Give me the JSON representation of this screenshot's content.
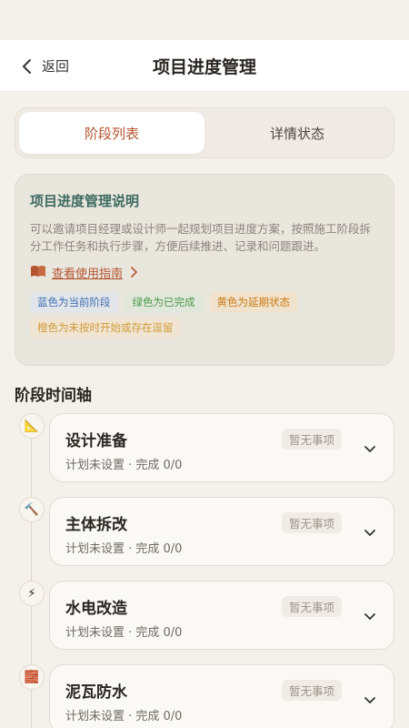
{
  "header": {
    "back_label": "返回",
    "title": "项目进度管理"
  },
  "tabs": [
    {
      "label": "阶段列表",
      "active": true
    },
    {
      "label": "详情状态",
      "active": false
    }
  ],
  "info": {
    "title": "项目进度管理说明",
    "description": "可以邀请项目经理或设计师一起规划项目进度方案，按照施工阶段拆分工作任务和执行步骤，方便后续推进、记录和问题跟进。",
    "guide_label": "查看使用指南",
    "legend": [
      {
        "label": "蓝色为当前阶段",
        "color": "#3e6fb2"
      },
      {
        "label": "绿色为已完成",
        "color": "#4c9a4c"
      },
      {
        "label": "黄色为延期状态",
        "color": "#c97a12"
      },
      {
        "label": "橙色为未按时开始或存在逗留",
        "color": "#d29a3a"
      }
    ]
  },
  "timeline": {
    "title": "阶段时间轴",
    "stages": [
      {
        "icon": "ruler-triangle-icon",
        "glyph": "📐",
        "name": "设计准备",
        "meta": "计划未设置 · 完成 0/0",
        "badge": "暂无事项"
      },
      {
        "icon": "hammer-icon",
        "glyph": "🔨",
        "name": "主体拆改",
        "meta": "计划未设置 · 完成 0/0",
        "badge": "暂无事项"
      },
      {
        "icon": "lightning-icon",
        "glyph": "⚡",
        "name": "水电改造",
        "meta": "计划未设置 · 完成 0/0",
        "badge": "暂无事项"
      },
      {
        "icon": "brick-icon",
        "glyph": "🧱",
        "name": "泥瓦防水",
        "meta": "计划未设置 · 完成 0/0",
        "badge": "暂无事项"
      }
    ]
  },
  "colors": {
    "accent": "#b5552f",
    "info_title": "#3d6a60"
  }
}
